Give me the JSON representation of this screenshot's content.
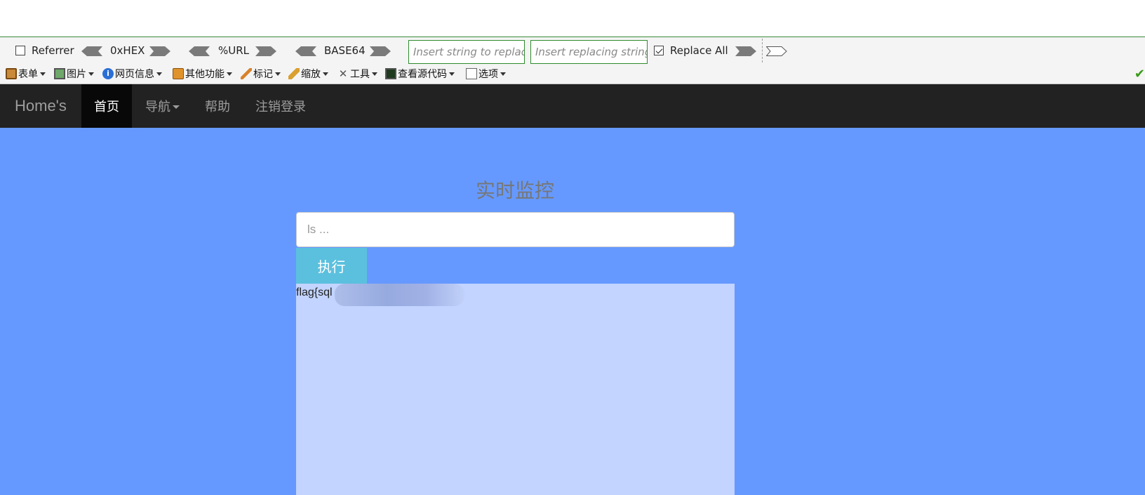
{
  "hackbar": {
    "referrer_label": "Referrer",
    "hex_label": "0xHEX",
    "url_label": "%URL",
    "base64_label": "BASE64",
    "search_placeholder": "Insert string to replace",
    "replace_placeholder": "Insert replacing string",
    "replace_all_label": "Replace All",
    "referrer_checked": false,
    "replace_all_checked": true
  },
  "menubar": {
    "items": [
      {
        "label": "表单",
        "icon": "clipboard-icon"
      },
      {
        "label": "图片",
        "icon": "image-icon"
      },
      {
        "label": "网页信息",
        "icon": "info-icon"
      },
      {
        "label": "其他功能",
        "icon": "book-icon"
      },
      {
        "label": "标记",
        "icon": "pencil-icon"
      },
      {
        "label": "缩放",
        "icon": "ruler-icon"
      },
      {
        "label": "工具",
        "icon": "tools-icon"
      },
      {
        "label": "查看源代码",
        "icon": "terminal-icon"
      },
      {
        "label": "选项",
        "icon": "options-icon"
      }
    ]
  },
  "navbar": {
    "brand": "Home's",
    "items": [
      {
        "label": "首页",
        "active": true
      },
      {
        "label": "导航",
        "dropdown": true
      },
      {
        "label": "帮助"
      },
      {
        "label": "注销登录"
      }
    ]
  },
  "main": {
    "title": "实时监控",
    "input_placeholder": "ls ...",
    "execute_label": "执行",
    "output_text": "flag{sql"
  },
  "colors": {
    "navbar_bg": "#222222",
    "page_bg": "#6699ff",
    "output_bg": "#c2d4ff",
    "button_bg": "#5bc0de"
  }
}
